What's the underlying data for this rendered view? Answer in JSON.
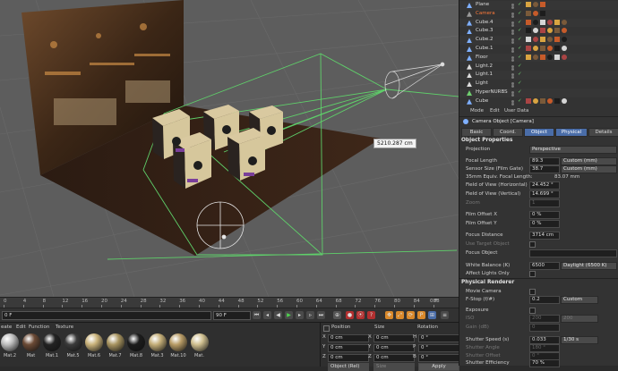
{
  "viewport": {
    "distance_label": "5210.287 cm"
  },
  "timeline": {
    "ticks": [
      "0",
      "4",
      "8",
      "12",
      "16",
      "20",
      "24",
      "28",
      "32",
      "36",
      "40",
      "44",
      "48",
      "52",
      "56",
      "60",
      "64",
      "68",
      "72",
      "76",
      "80",
      "84",
      "88"
    ],
    "end_marker": "0 F",
    "current_frame": "0 F",
    "end_frame": "90 F"
  },
  "materials": {
    "menu": [
      "eate",
      "Edit",
      "Function",
      "Texture"
    ],
    "items": [
      {
        "name": "Mat.2",
        "color": "#bdbdbd"
      },
      {
        "name": "Mat",
        "color": "#6b4a35"
      },
      {
        "name": "Mat.1",
        "color": "#222222"
      },
      {
        "name": "Mat.5",
        "color": "#3a3a3a"
      },
      {
        "name": "Mat.6",
        "color": "#c9b27a"
      },
      {
        "name": "Mat.7",
        "color": "#a89460"
      },
      {
        "name": "Mat.8",
        "color": "#1c1c1c"
      },
      {
        "name": "Mat.3",
        "color": "#c4ae78"
      },
      {
        "name": "Mat.10",
        "color": "#b89c66"
      },
      {
        "name": "Mat.",
        "color": "#d0c090"
      }
    ]
  },
  "coordinates": {
    "headers": [
      "Position",
      "Size",
      "Rotation"
    ],
    "rows": [
      {
        "axis": "X",
        "pos": "0 cm",
        "size_axis": "X",
        "size": "0 cm",
        "rot_axis": "H",
        "rot": "0 °"
      },
      {
        "axis": "Y",
        "pos": "0 cm",
        "size_axis": "Y",
        "size": "0 cm",
        "rot_axis": "P",
        "rot": "0 °"
      },
      {
        "axis": "Z",
        "pos": "0 cm",
        "size_axis": "Z",
        "size": "0 cm",
        "rot_axis": "B",
        "rot": "0 °"
      }
    ],
    "mode": "Object (Rel)",
    "size_mode": "Size",
    "apply": "Apply"
  },
  "objects": [
    {
      "name": "Plane",
      "color": "#dcdcdc",
      "icon_color": "#7fb0ff"
    },
    {
      "name": "Camera",
      "color": "#ff7a3a",
      "icon_color": "#9a9a9a"
    },
    {
      "name": "Cube.4",
      "color": "#dcdcdc",
      "icon_color": "#7fb0ff"
    },
    {
      "name": "Cube.3",
      "color": "#dcdcdc",
      "icon_color": "#7fb0ff"
    },
    {
      "name": "Cube.2",
      "color": "#dcdcdc",
      "icon_color": "#7fb0ff"
    },
    {
      "name": "Cube.1",
      "color": "#dcdcdc",
      "icon_color": "#7fb0ff"
    },
    {
      "name": "Floor",
      "color": "#dcdcdc",
      "icon_color": "#7fb0ff"
    },
    {
      "name": "Light.2",
      "color": "#dcdcdc",
      "icon_color": "#dddddd"
    },
    {
      "name": "Light.1",
      "color": "#dcdcdc",
      "icon_color": "#dddddd"
    },
    {
      "name": "Light",
      "color": "#dcdcdc",
      "icon_color": "#dddddd"
    },
    {
      "name": "HyperNURBS",
      "color": "#dcdcdc",
      "icon_color": "#6fcf6f"
    },
    {
      "name": "Cube",
      "color": "#dcdcdc",
      "icon_color": "#7fb0ff"
    }
  ],
  "attributes": {
    "menu": [
      "Mode",
      "Edit",
      "User Data"
    ],
    "title": "Camera Object [Camera]",
    "tabs": [
      "Basic",
      "Coord.",
      "Object",
      "Physical",
      "Details"
    ],
    "object_props_header": "Object Properties",
    "projection": {
      "label": "Projection",
      "value": "Perspective"
    },
    "focal_length": {
      "label": "Focal Length",
      "value": "89.3",
      "preset": "Custom (mm)"
    },
    "sensor_size": {
      "label": "Sensor Size (Film Gate)",
      "value": "38.7",
      "preset": "Custom (mm)"
    },
    "equiv_focal": {
      "label": "35mm Equiv. Focal Length:",
      "value": "83.07 mm"
    },
    "fov_h": {
      "label": "Field of View (Horizontal)",
      "value": "24.452 °"
    },
    "fov_v": {
      "label": "Field of View (Vertical)",
      "value": "14.699 °"
    },
    "zoom": {
      "label": "Zoom",
      "value": "1"
    },
    "film_offset_x": {
      "label": "Film Offset X",
      "value": "0 %"
    },
    "film_offset_y": {
      "label": "Film Offset Y",
      "value": "0 %"
    },
    "focus_distance": {
      "label": "Focus Distance",
      "value": "3714 cm"
    },
    "use_target": {
      "label": "Use Target Object"
    },
    "focus_object": {
      "label": "Focus Object"
    },
    "white_balance": {
      "label": "White Balance (K)",
      "value": "6500",
      "preset": "Daylight (6500 K)"
    },
    "affect_lights": {
      "label": "Affect Lights Only"
    },
    "physical_header": "Physical Renderer",
    "movie_camera": {
      "label": "Movie Camera"
    },
    "fstop": {
      "label": "F-Stop (f/#)",
      "value": "0.2",
      "preset": "Custom"
    },
    "exposure": {
      "label": "Exposure"
    },
    "iso": {
      "label": "ISO",
      "value": "200",
      "preset": "200"
    },
    "gain": {
      "label": "Gain (dB)",
      "value": "0"
    },
    "shutter_speed": {
      "label": "Shutter Speed (s)",
      "value": "0.033",
      "preset": "1/30 s"
    },
    "shutter_angle": {
      "label": "Shutter Angle",
      "value": "180 °"
    },
    "shutter_offset": {
      "label": "Shutter Offset",
      "value": "0 °"
    },
    "shutter_eff": {
      "label": "Shutter Efficiency",
      "value": "70 %"
    }
  }
}
